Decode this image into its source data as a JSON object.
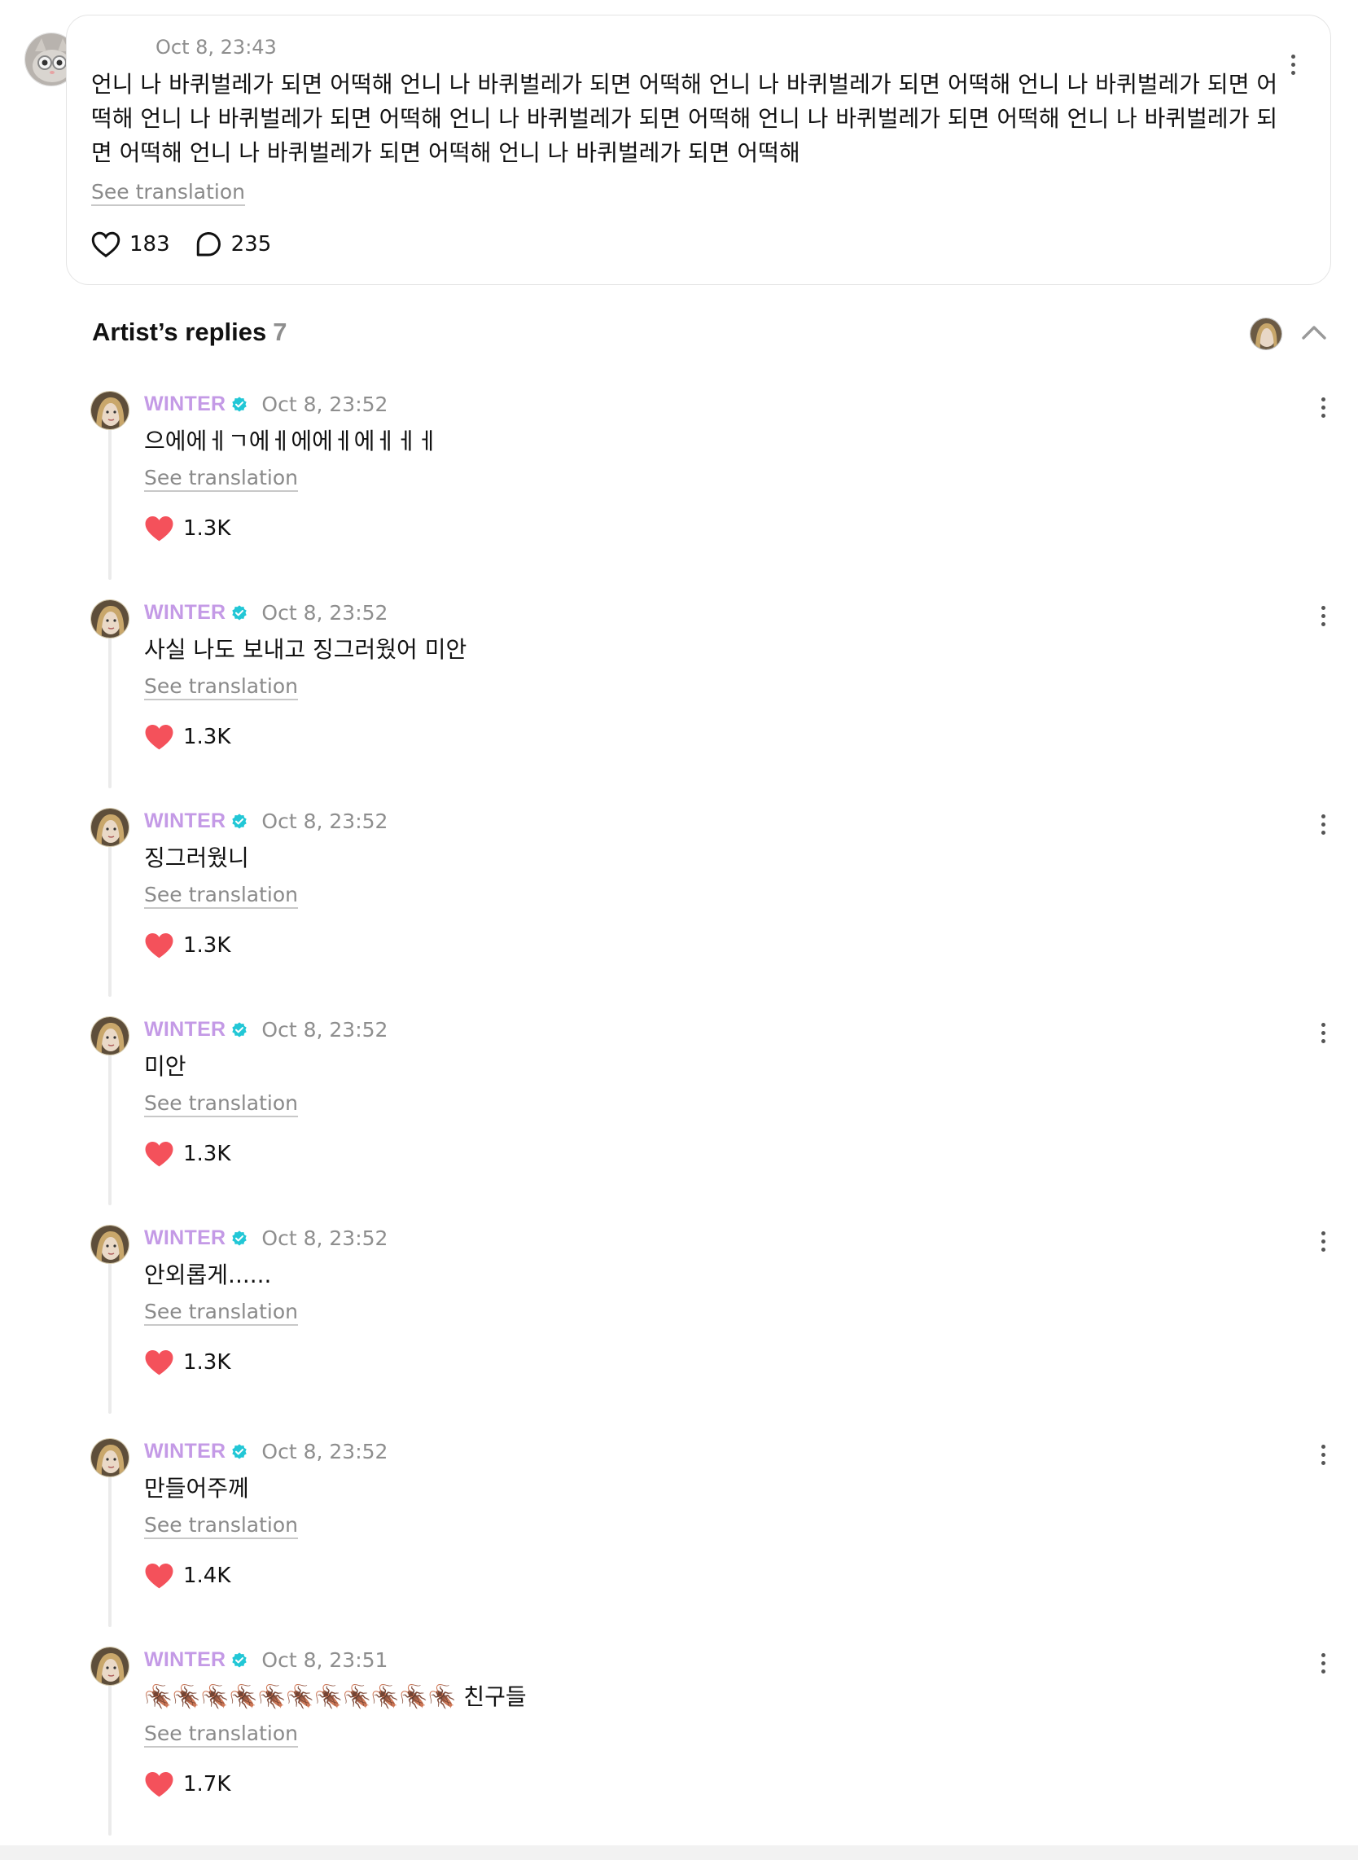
{
  "post": {
    "timestamp": "Oct 8, 23:43",
    "text": "언니 나 바퀴벌레가 되면 어떡해 언니 나 바퀴벌레가 되면 어떡해 언니 나 바퀴벌레가 되면 어떡해 언니 나 바퀴벌레가 되면 어떡해 언니 나 바퀴벌레가 되면 어떡해 언니 나 바퀴벌레가 되면 어떡해 언니 나 바퀴벌레가 되면 어떡해 언니 나 바퀴벌레가 되면 어떡해 언니 나 바퀴벌레가 되면 어떡해 언니 나 바퀴벌레가 되면 어떡해",
    "see_translation": "See translation",
    "likes": "183",
    "comments": "235"
  },
  "artist_replies": {
    "title": "Artist’s replies",
    "count": "7"
  },
  "replies": [
    {
      "author": "WINTER",
      "timestamp": "Oct 8, 23:52",
      "text": "으에에ㅔㄱ에ㅔ에에ㅔ에ㅔㅔㅔ",
      "see_translation": "See translation",
      "likes": "1.3K"
    },
    {
      "author": "WINTER",
      "timestamp": "Oct 8, 23:52",
      "text": "사실 나도 보내고 징그러웠어 미안",
      "see_translation": "See translation",
      "likes": "1.3K"
    },
    {
      "author": "WINTER",
      "timestamp": "Oct 8, 23:52",
      "text": "징그러웠니",
      "see_translation": "See translation",
      "likes": "1.3K"
    },
    {
      "author": "WINTER",
      "timestamp": "Oct 8, 23:52",
      "text": "미안",
      "see_translation": "See translation",
      "likes": "1.3K"
    },
    {
      "author": "WINTER",
      "timestamp": "Oct 8, 23:52",
      "text": "안외롭게......",
      "see_translation": "See translation",
      "likes": "1.3K"
    },
    {
      "author": "WINTER",
      "timestamp": "Oct 8, 23:52",
      "text": "만들어주께",
      "see_translation": "See translation",
      "likes": "1.4K"
    },
    {
      "author": "WINTER",
      "timestamp": "Oct 8, 23:51",
      "text": "🪳🪳🪳🪳🪳🪳🪳🪳🪳🪳🪳 친구들",
      "see_translation": "See translation",
      "likes": "1.7K"
    }
  ],
  "icons": {
    "post_like": "heart-outline-icon",
    "post_comment": "comment-bubble-icon",
    "reply_like": "heart-filled-icon",
    "verified": "verified-badge-icon",
    "more": "more-vertical-icon",
    "collapse": "chevron-up-icon"
  },
  "colors": {
    "author": "#c49ae6",
    "verified_badge": "#22c7d6",
    "heart": "#f4515b",
    "muted_text": "#8e8e8e"
  }
}
